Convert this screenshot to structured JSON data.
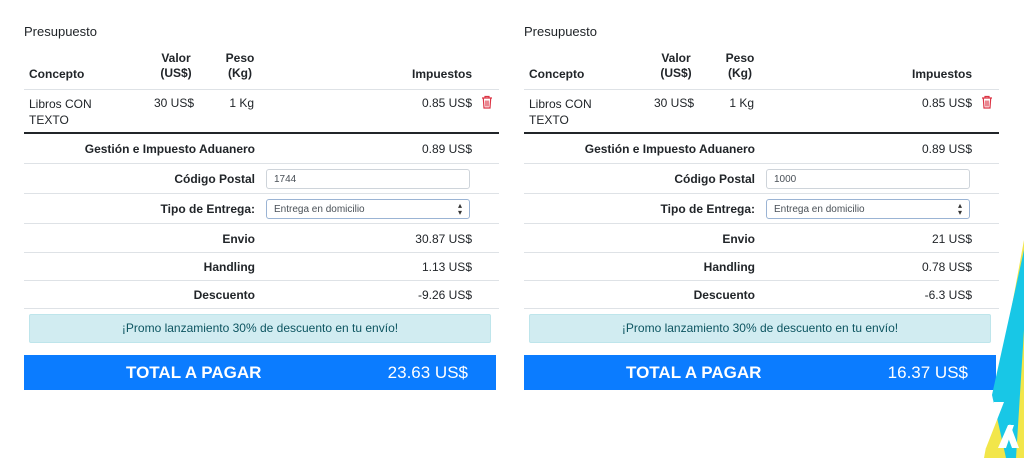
{
  "panels": [
    {
      "title": "Presupuesto",
      "headers": {
        "concepto": "Concepto",
        "valor": "Valor (US$)",
        "peso": "Peso (Kg)",
        "impuestos": "Impuestos"
      },
      "item": {
        "concepto": "Libros CON TEXTO",
        "valor": "30 US$",
        "peso": "1 Kg",
        "impuestos": "0.85 US$"
      },
      "gestion": {
        "label": "Gestión e Impuesto Aduanero",
        "value": "0.89 US$"
      },
      "codigo_postal": {
        "label": "Código Postal",
        "value": "1744"
      },
      "tipo_entrega": {
        "label": "Tipo de Entrega:",
        "value": "Entrega en domicilio"
      },
      "envio": {
        "label": "Envio",
        "value": "30.87 US$"
      },
      "handling": {
        "label": "Handling",
        "value": "1.13 US$"
      },
      "descuento": {
        "label": "Descuento",
        "value": "-9.26 US$"
      },
      "promo": "¡Promo lanzamiento 30% de descuento en tu envío!",
      "total": {
        "label": "TOTAL A PAGAR",
        "value": "23.63 US$"
      }
    },
    {
      "title": "Presupuesto",
      "headers": {
        "concepto": "Concepto",
        "valor": "Valor (US$)",
        "peso": "Peso (Kg)",
        "impuestos": "Impuestos"
      },
      "item": {
        "concepto": "Libros CON TEXTO",
        "valor": "30 US$",
        "peso": "1 Kg",
        "impuestos": "0.85 US$"
      },
      "gestion": {
        "label": "Gestión e Impuesto Aduanero",
        "value": "0.89 US$"
      },
      "codigo_postal": {
        "label": "Código Postal",
        "value": "1000"
      },
      "tipo_entrega": {
        "label": "Tipo de Entrega:",
        "value": "Entrega en domicilio"
      },
      "envio": {
        "label": "Envio",
        "value": "21 US$"
      },
      "handling": {
        "label": "Handling",
        "value": "0.78 US$"
      },
      "descuento": {
        "label": "Descuento",
        "value": "-6.3 US$"
      },
      "promo": "¡Promo lanzamiento 30% de descuento en tu envío!",
      "total": {
        "label": "TOTAL A PAGAR",
        "value": "16.37 US$"
      }
    }
  ],
  "icons": {
    "delete": "trash-icon",
    "select": "select-arrows-icon",
    "brand": "brand-logo"
  },
  "colors": {
    "total_bg": "#0b7cff",
    "promo_bg": "#d1ecf1",
    "promo_text": "#0c5460",
    "trash": "#dc3545",
    "logo_yellow": "#f2e64a",
    "logo_cyan": "#18c7e6"
  }
}
